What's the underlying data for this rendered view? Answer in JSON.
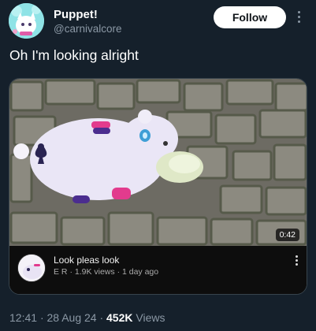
{
  "tweet": {
    "display_name": "Puppet!",
    "handle": "@carnivalcore",
    "follow_label": "Follow",
    "text": "Oh I'm looking alright"
  },
  "video": {
    "duration": "0:42",
    "title": "Look pleas look",
    "channel_initials": "E R",
    "views": "1.9K views",
    "age": "1 day ago"
  },
  "footer": {
    "time": "12:41",
    "date": "28 Aug 24",
    "views_count": "452K",
    "views_label": "Views"
  },
  "colors": {
    "background": "#15202b",
    "secondary_text": "#8b98a5",
    "card_border": "#38444d",
    "follow_button": "#ffffff"
  },
  "icons": [
    "more-icon",
    "avatar",
    "video-menu-icon",
    "card-suit-icon"
  ]
}
